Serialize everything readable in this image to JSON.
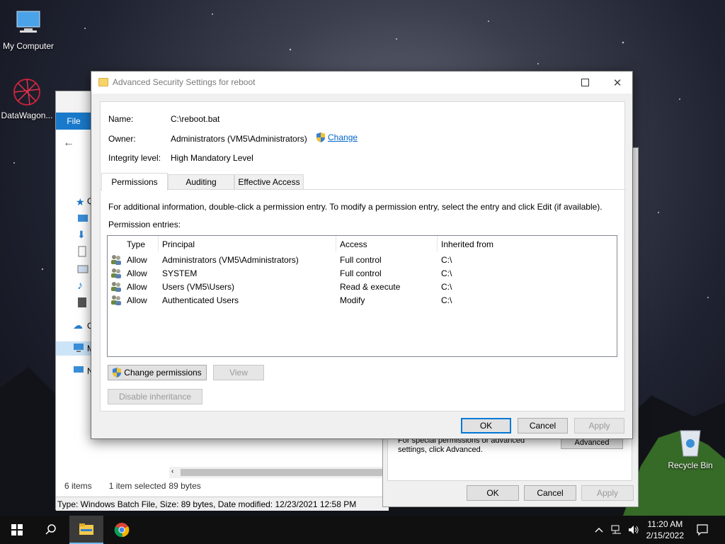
{
  "desktop": {
    "icons": [
      {
        "label": "My Computer",
        "icon": "monitor-icon"
      },
      {
        "label": "DataWagon...",
        "icon": "datawagon-icon"
      },
      {
        "label": "Recycle Bin",
        "icon": "recycle-bin-icon"
      }
    ]
  },
  "explorer": {
    "file_tab": "File",
    "sidebar_letters": [
      "Q",
      "O",
      "M",
      "N"
    ],
    "status": {
      "items": "6 items",
      "selected": "1 item selected",
      "size": "89 bytes"
    },
    "type_bar": "Type: Windows Batch File, Size: 89 bytes, Date modified: 12/23/2021 12:58 PM"
  },
  "properties": {
    "hint": "For special permissions or advanced settings, click Advanced.",
    "advanced_button": "Advanced",
    "ok": "OK",
    "cancel": "Cancel",
    "apply": "Apply"
  },
  "dialog": {
    "title": "Advanced Security Settings for reboot",
    "name_label": "Name:",
    "name_value": "C:\\reboot.bat",
    "owner_label": "Owner:",
    "owner_value": "Administrators (VM5\\Administrators)",
    "owner_change": "Change",
    "integrity_label": "Integrity level:",
    "integrity_value": "High Mandatory Level",
    "tabs": [
      "Permissions",
      "Auditing",
      "Effective Access"
    ],
    "instructions": "For additional information, double-click a permission entry. To modify a permission entry, select the entry and click Edit (if available).",
    "entries_label": "Permission entries:",
    "columns": [
      "Type",
      "Principal",
      "Access",
      "Inherited from"
    ],
    "entries": [
      {
        "type": "Allow",
        "principal": "Administrators (VM5\\Administrators)",
        "access": "Full control",
        "inherited": "C:\\"
      },
      {
        "type": "Allow",
        "principal": "SYSTEM",
        "access": "Full control",
        "inherited": "C:\\"
      },
      {
        "type": "Allow",
        "principal": "Users (VM5\\Users)",
        "access": "Read & execute",
        "inherited": "C:\\"
      },
      {
        "type": "Allow",
        "principal": "Authenticated Users",
        "access": "Modify",
        "inherited": "C:\\"
      }
    ],
    "change_permissions": "Change permissions",
    "view": "View",
    "disable_inheritance": "Disable inheritance",
    "ok": "OK",
    "cancel": "Cancel",
    "apply": "Apply"
  },
  "taskbar": {
    "time": "11:20 AM",
    "date": "2/15/2022"
  },
  "colors": {
    "accent": "#0078d7",
    "link": "#0066cc",
    "taskbar": "#101010"
  }
}
